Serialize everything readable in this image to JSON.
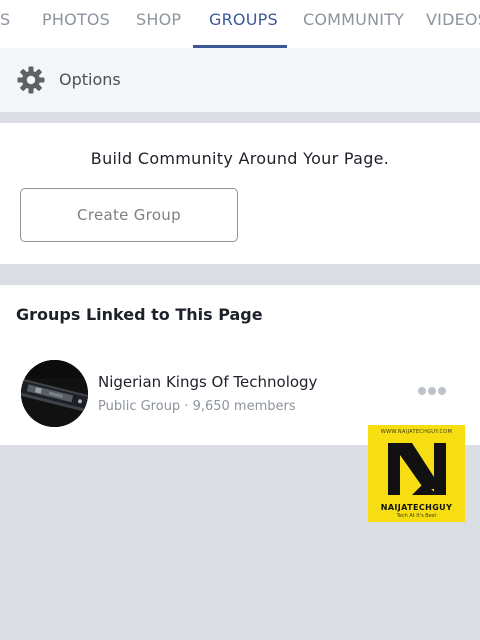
{
  "tabs": [
    {
      "label": "S"
    },
    {
      "label": "PHOTOS"
    },
    {
      "label": "SHOP"
    },
    {
      "label": "GROUPS",
      "active": true
    },
    {
      "label": "COMMUNITY"
    },
    {
      "label": "VIDEOS"
    }
  ],
  "options": {
    "icon": "gear-icon",
    "label": "Options"
  },
  "build": {
    "text": "Build Community Around Your Page.",
    "button_label": "Create Group"
  },
  "groups": {
    "heading": "Groups Linked to This Page",
    "items": [
      {
        "name": "Nigerian Kings Of Technology",
        "meta": "Public Group · 9,650 members",
        "more_icon": "more-horizontal-icon"
      }
    ]
  },
  "watermark": {
    "url": "WWW.NAIJATECHGUY.COM",
    "name": "NAIJATECHGUY",
    "tagline": "Tech At It's Best"
  },
  "colors": {
    "accent": "#3b5998",
    "background": "#dadde1",
    "watermark_yellow": "#f7de12"
  }
}
